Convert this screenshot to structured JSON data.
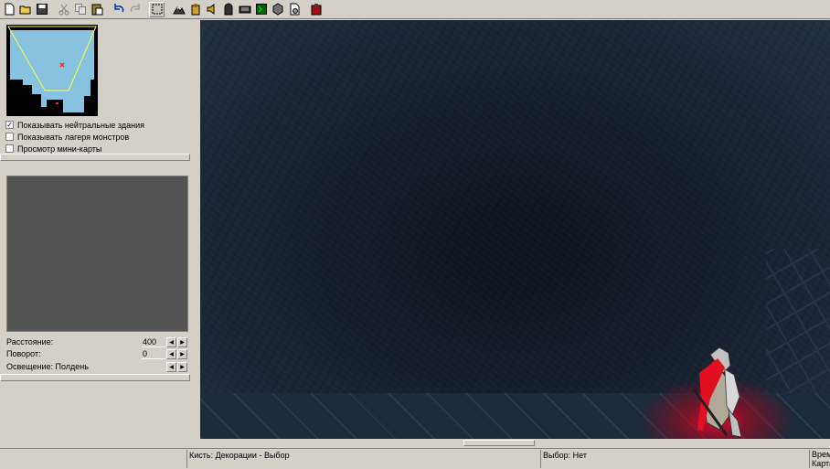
{
  "toolbar": {
    "buttons": [
      {
        "name": "new-file-icon"
      },
      {
        "name": "open-folder-icon"
      },
      {
        "name": "save-icon"
      },
      {
        "name": "cut-icon"
      },
      {
        "name": "copy-icon"
      },
      {
        "name": "paste-icon"
      },
      {
        "name": "undo-icon"
      },
      {
        "name": "redo-icon"
      },
      {
        "name": "selection-icon"
      },
      {
        "name": "terrain-palette-icon"
      },
      {
        "name": "unit-palette-icon"
      },
      {
        "name": "sound-editor-icon"
      },
      {
        "name": "camera-icon"
      },
      {
        "name": "keyboard-icon"
      },
      {
        "name": "trigger-editor-icon"
      },
      {
        "name": "object-editor-icon"
      },
      {
        "name": "import-manager-icon"
      },
      {
        "name": "test-map-icon"
      }
    ]
  },
  "minimap": {
    "marker_color": "#ff2020",
    "sky_color": "#87c3e0"
  },
  "options": {
    "show_neutral": {
      "label": "Показывать нейтральные здания",
      "checked": true
    },
    "show_camps": {
      "label": "Показывать лагеря монстров",
      "checked": false
    },
    "minimap_preview": {
      "label": "Просмотр мини-карты",
      "checked": false
    }
  },
  "preview_props": {
    "distance_label": "Расстояние:",
    "distance_value": "400",
    "rotation_label": "Поворот:",
    "rotation_value": "0",
    "lighting_label": "Освещение: Полдень"
  },
  "status": {
    "brush": "Кисть: Декорации - Выбор",
    "selection": "Выбор: Нет",
    "time_label": "Врем",
    "map_label": "Карта"
  }
}
